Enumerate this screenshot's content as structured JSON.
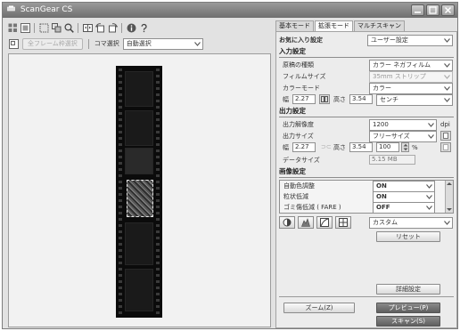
{
  "window": {
    "title": "ScanGear CS"
  },
  "toolbar2": {
    "disabled_button_label": "全フレーム枠選択",
    "frame_select_label": "コマ選択",
    "frame_select_value": "自動選択"
  },
  "tabs": [
    {
      "label": "基本モード"
    },
    {
      "label": "拡張モード"
    },
    {
      "label": "マルチスキャン"
    }
  ],
  "favorites": {
    "label": "お気に入り設定",
    "value": "ユーザー設定"
  },
  "input_settings": {
    "heading": "入力設定",
    "doc_type_label": "原稿の種類",
    "doc_type_value": "カラー ネガフィルム",
    "film_size_label": "フィルムサイズ",
    "film_size_value": "35mm ストリップ",
    "color_mode_label": "カラーモード",
    "color_mode_value": "カラー",
    "width_label": "幅",
    "width_value": "2.27",
    "height_label": "高さ",
    "height_value": "3.54",
    "unit_value": "センチ"
  },
  "output_settings": {
    "heading": "出力設定",
    "resolution_label": "出力解像度",
    "resolution_value": "1200",
    "resolution_unit": "dpi",
    "size_label": "出力サイズ",
    "size_value": "フリーサイズ",
    "width_label": "幅",
    "width_value": "2.27",
    "height_label": "高さ",
    "height_value": "3.54",
    "scale_value": "100",
    "scale_unit": "%",
    "data_size_label": "データサイズ",
    "data_size_value": "5.15 MB"
  },
  "image_settings": {
    "heading": "画像設定",
    "items": [
      {
        "label": "自動色調整",
        "value": "ON"
      },
      {
        "label": "粒状低減",
        "value": "ON"
      },
      {
        "label": "ゴミ傷低減 ( FARE )",
        "value": "OFF"
      }
    ]
  },
  "adjust": {
    "preset_value": "カスタム",
    "reset_label": "リセット",
    "detail_label": "詳細設定"
  },
  "bottom": {
    "zoom_label": "ズーム(Z)",
    "preview_label": "プレビュー(P)",
    "scan_label": "スキャン(S)"
  }
}
